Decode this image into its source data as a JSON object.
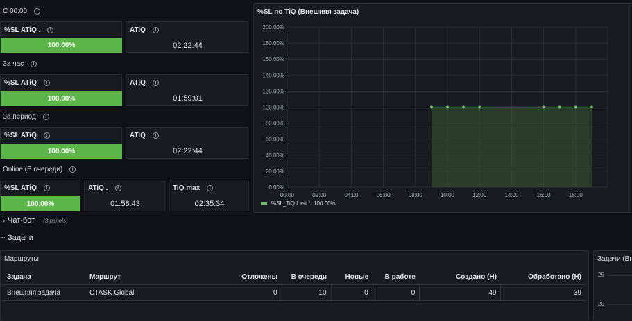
{
  "rows": {
    "today": "С 00:00",
    "hour": "За час",
    "period": "За период",
    "online": "Online (В очереди)"
  },
  "stats": {
    "today": {
      "sl_title": "%SL ATiQ .",
      "sl_value": "100.00%",
      "sl_fraction": 1.0,
      "atiq_title": "ATiQ",
      "atiq_value": "02:22:44"
    },
    "hour": {
      "sl_title": "%SL ATiQ",
      "sl_value": "100.00%",
      "sl_fraction": 1.0,
      "atiq_title": "ATiQ",
      "atiq_value": "01:59:01"
    },
    "period": {
      "sl_title": "%SL ATiQ",
      "sl_value": "100.00%",
      "sl_fraction": 1.0,
      "atiq_title": "ATiQ",
      "atiq_value": "02:22:44"
    },
    "online": {
      "sl_title": "%SL ATiQ",
      "sl_value": "100.00%",
      "sl_fraction": 1.0,
      "atiq_title": "ATiQ .",
      "atiq_value": "01:58:43",
      "tiqmax_title": "TiQ max",
      "tiqmax_value": "02:35:34"
    }
  },
  "chart_panel": {
    "title": "%SL по TiQ (Внешняя задача)"
  },
  "chart_data": {
    "type": "area",
    "title": "%SL по TiQ (Внешняя задача)",
    "x_ticks": [
      "00:00",
      "02:00",
      "04:00",
      "06:00",
      "08:00",
      "10:00",
      "12:00",
      "14:00",
      "16:00",
      "18:00"
    ],
    "y_ticks": [
      "0.00%",
      "20.00%",
      "40.00%",
      "60.00%",
      "80.00%",
      "100.00%",
      "120.00%",
      "140.00%",
      "160.00%",
      "180.00%",
      "200.00%"
    ],
    "xlim": [
      0,
      20
    ],
    "ylim": [
      0,
      200
    ],
    "series": [
      {
        "name": "%SL_TiQ",
        "x": [
          9,
          10,
          11,
          12,
          16,
          17,
          18,
          19
        ],
        "y": [
          100,
          100,
          100,
          100,
          100,
          100,
          100,
          100
        ]
      }
    ],
    "fill_range": [
      9,
      19
    ],
    "legend": {
      "name": "%SL_TiQ",
      "last": "Last *: 100.00%"
    },
    "grid": true,
    "colors": {
      "line": "#73bf69"
    }
  },
  "sections": {
    "chatbot": {
      "title": "Чат-бот",
      "sub": "(3 panels)"
    },
    "tasks": {
      "title": "Задачи"
    }
  },
  "routes": {
    "title": "Маршруты",
    "columns": [
      "Задача",
      "Маршрут",
      "Отложены",
      "В очереди",
      "Новые",
      "В работе",
      "Создано (Н)",
      "Обработано (Н)"
    ],
    "rows": [
      [
        "Внешняя задача",
        "CTASK Global",
        "0",
        "10",
        "0",
        "0",
        "49",
        "39"
      ]
    ]
  },
  "side_panel": {
    "title": "Задачи (Вн",
    "y_ticks": [
      "25",
      "20"
    ]
  },
  "colors": {
    "accent": "#5cb548",
    "background": "#111217",
    "panel": "#181b1f"
  }
}
